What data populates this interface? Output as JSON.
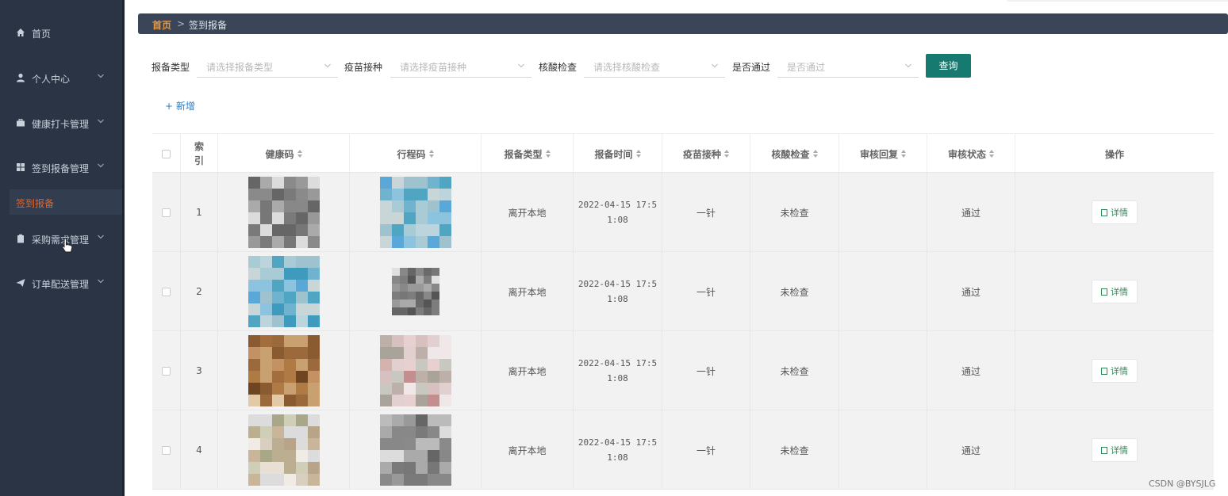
{
  "sidebar": {
    "items": [
      {
        "label": "首页",
        "icon": "home-icon",
        "has_children": false
      },
      {
        "label": "个人中心",
        "icon": "user-icon",
        "has_children": true
      },
      {
        "label": "健康打卡管理",
        "icon": "briefcase-icon",
        "has_children": true
      },
      {
        "label": "签到报备管理",
        "icon": "grid-icon",
        "has_children": true
      },
      {
        "label": "采购需求管理",
        "icon": "clipboard-icon",
        "has_children": true
      },
      {
        "label": "订单配送管理",
        "icon": "send-icon",
        "has_children": true
      }
    ],
    "active_sub": "签到报备",
    "colors": {
      "background": "#2a3444",
      "active_text": "#e0652c"
    }
  },
  "breadcrumb": {
    "home": "首页",
    "separator": ">",
    "current": "签到报备"
  },
  "filters": [
    {
      "label": "报备类型",
      "placeholder": "请选择报备类型"
    },
    {
      "label": "疫苗接种",
      "placeholder": "请选择疫苗接种"
    },
    {
      "label": "核酸检查",
      "placeholder": "请选择核酸检查"
    },
    {
      "label": "是否通过",
      "placeholder": "是否通过"
    }
  ],
  "query_label": "查询",
  "add_label": "+ 新增",
  "table": {
    "columns": [
      "索引",
      "健康码",
      "行程码",
      "报备类型",
      "报备时间",
      "疫苗接种",
      "核酸检查",
      "审核回复",
      "审核状态",
      "操作"
    ],
    "rows": [
      {
        "index": "1",
        "type": "离开本地",
        "time": "2022-04-15 17:51:08",
        "vaccine": "一针",
        "nucleic": "未检查",
        "reply": "",
        "status": "通过",
        "action": "详情"
      },
      {
        "index": "2",
        "type": "离开本地",
        "time": "2022-04-15 17:51:08",
        "vaccine": "一针",
        "nucleic": "未检查",
        "reply": "",
        "status": "通过",
        "action": "详情"
      },
      {
        "index": "3",
        "type": "离开本地",
        "time": "2022-04-15 17:51:08",
        "vaccine": "一针",
        "nucleic": "未检查",
        "reply": "",
        "status": "通过",
        "action": "详情"
      },
      {
        "index": "4",
        "type": "离开本地",
        "time": "2022-04-15 17:51:08",
        "vaccine": "一针",
        "nucleic": "未检查",
        "reply": "",
        "status": "通过",
        "action": "详情"
      }
    ]
  },
  "accent_color": "#167a71",
  "watermark": "CSDN @BYSJLG"
}
